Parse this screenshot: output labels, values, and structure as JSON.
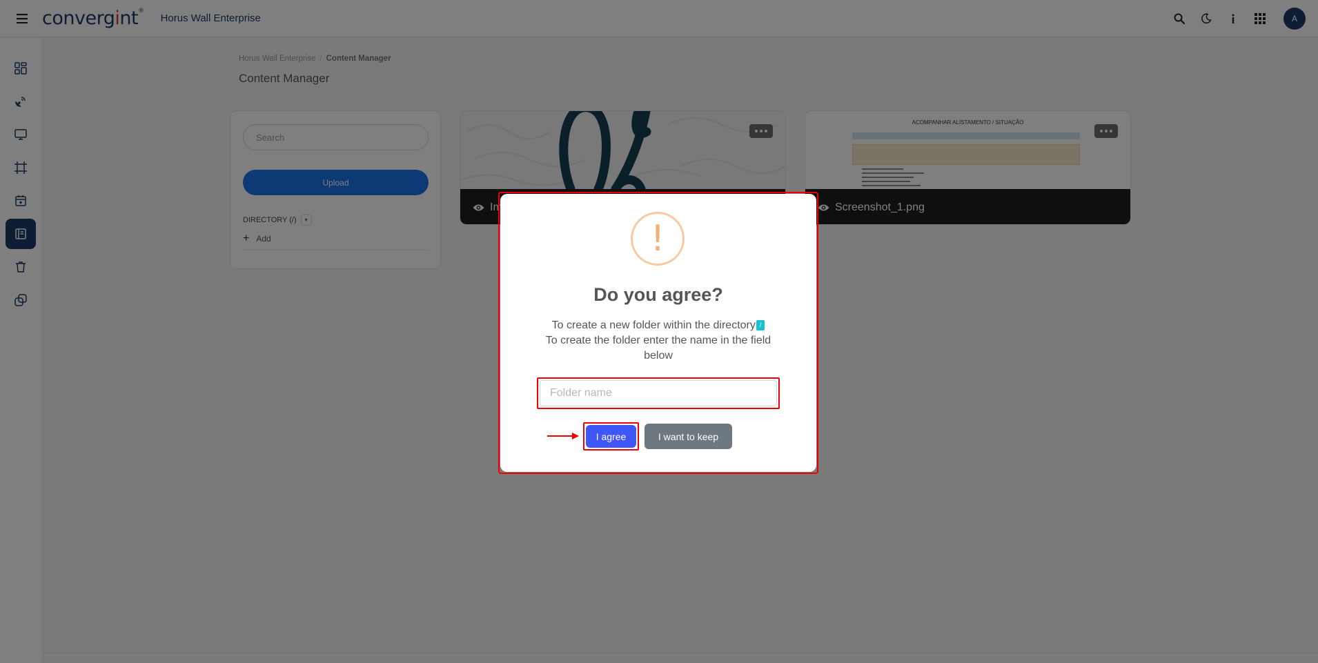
{
  "header": {
    "logo_main": "converg",
    "logo_dot": "i",
    "logo_tail": "nt",
    "logo_tm": "®",
    "product": "Horus Wall Enterprise",
    "avatar_initial": "A"
  },
  "sidebar": {
    "icons": [
      "dashboard-icon",
      "satellite-icon",
      "monitor-icon",
      "crop-icon",
      "calendar-icon",
      "content-manager-icon",
      "trash-icon",
      "layers-icon"
    ],
    "active_index": 5
  },
  "breadcrumb": {
    "root": "Horus Wall Enterprise",
    "separator": "/",
    "current": "Content Manager"
  },
  "page_title": "Content Manager",
  "left_panel": {
    "search_placeholder": "Search",
    "upload_label": "Upload",
    "directory_label": "DIRECTORY (/)",
    "add_label": "Add"
  },
  "cards": [
    {
      "filename": "Im"
    },
    {
      "filename": "Screenshot_1.png",
      "doc_title": "ACOMPANHAR ALISTAMENTO / SITUAÇÃO"
    }
  ],
  "modal": {
    "title": "Do you agree?",
    "line1": "To create a new folder within the directory",
    "directory_chip": "/",
    "line2": "To create the folder enter the name in the field below",
    "folder_placeholder": "Folder name",
    "confirm_label": "I agree",
    "cancel_label": "I want to keep"
  },
  "colors": {
    "brand_navy": "#1c3b66",
    "upload_blue": "#1a73e8",
    "confirm_blue": "#3f57f6",
    "cancel_gray": "#6e7881",
    "warning_orange": "#f8c9a1",
    "highlight_red": "#e00000",
    "chip_cyan": "#17c2d0"
  }
}
